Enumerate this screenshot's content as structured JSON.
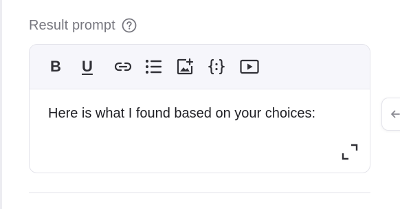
{
  "field": {
    "label": "Result prompt",
    "help_icon": "question-circle-icon"
  },
  "toolbar": {
    "bold_label": "B",
    "underline_label": "U",
    "icons": [
      "bold-icon",
      "underline-icon",
      "link-icon",
      "bullet-list-icon",
      "add-image-icon",
      "variable-braces-icon",
      "video-play-icon"
    ]
  },
  "editor": {
    "content": "Here is what I found based on your choices:",
    "expand_icon": "expand-icon"
  },
  "side_tab": {
    "icon": "arrow-left-icon"
  },
  "colors": {
    "label": "#77777f",
    "toolbar_bg": "#f6f6fb",
    "border": "#e3e3ea",
    "text": "#1f1f24",
    "icon": "#303036"
  }
}
